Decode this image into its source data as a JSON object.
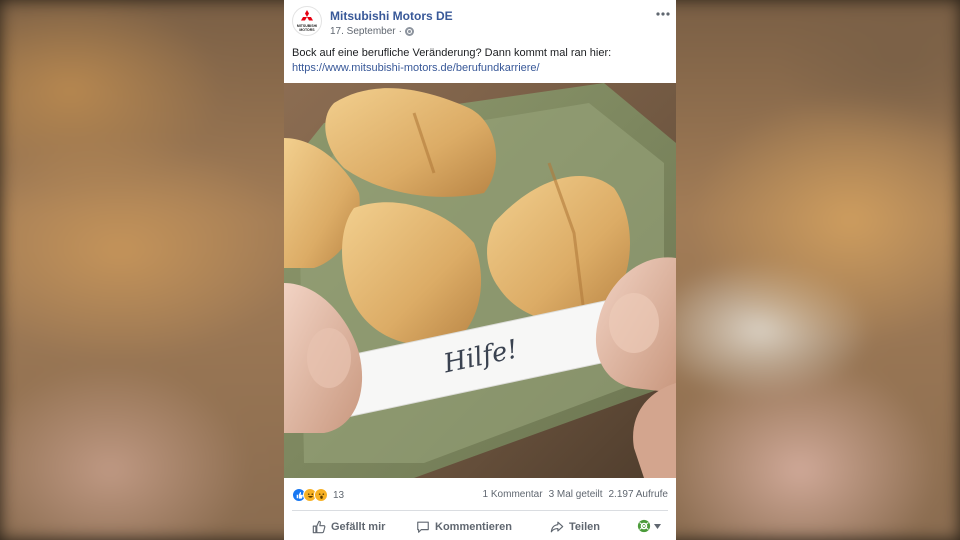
{
  "post": {
    "page_name": "Mitsubishi Motors DE",
    "date": "17. September",
    "separator": "·",
    "visibility_icon": "globe-icon",
    "more_icon": "ellipsis-icon",
    "avatar_logo_text_1": "MITSUBISHI",
    "avatar_logo_text_2": "MOTORS",
    "text": "Bock auf eine berufliche Veränderung? Dann kommt mal ran hier:",
    "link": "https://www.mitsubishi-motors.de/berufundkarriere/",
    "image": {
      "note_text": "Hilfe!"
    },
    "stats": {
      "reaction_count": "13",
      "comments": "1 Kommentar",
      "shares": "3 Mal geteilt",
      "views": "2.197 Aufrufe"
    },
    "actions": {
      "like": "Gefällt mir",
      "comment": "Kommentieren",
      "share": "Teilen"
    }
  },
  "colors": {
    "link": "#385898",
    "secondary_text": "#606770",
    "like_blue": "#1877f2",
    "brand_red": "#e60012"
  }
}
